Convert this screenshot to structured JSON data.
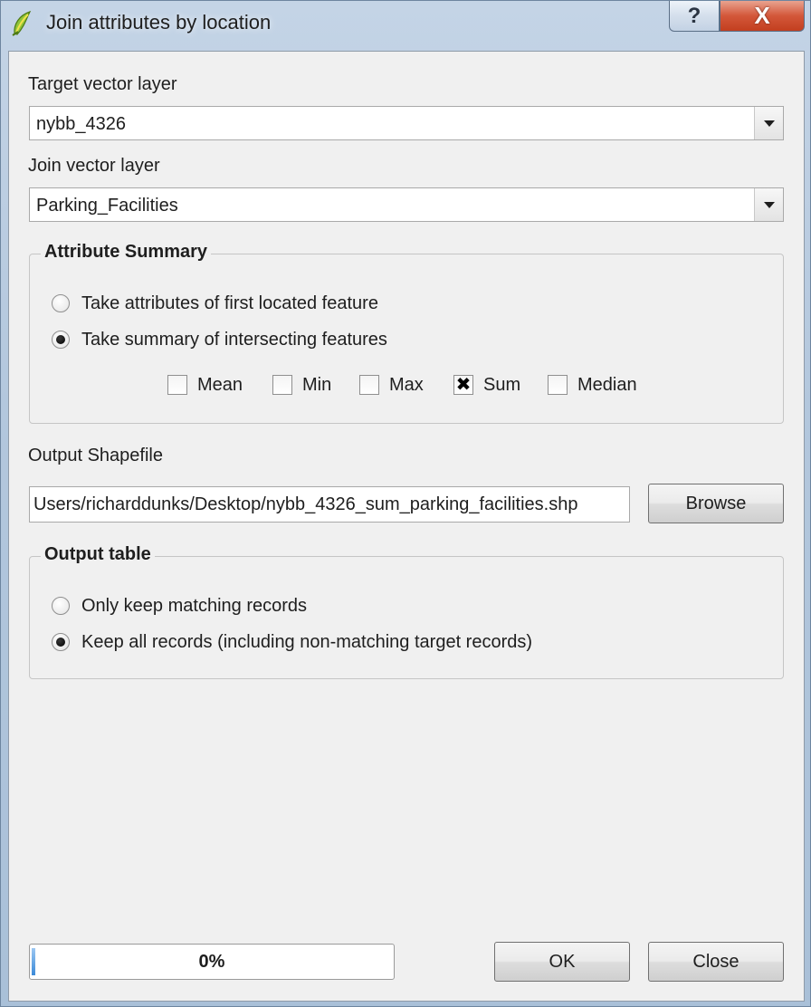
{
  "window": {
    "title": "Join attributes by location",
    "help_label": "?",
    "close_label": "X"
  },
  "target": {
    "label": "Target vector layer",
    "value": "nybb_4326"
  },
  "join": {
    "label": "Join vector layer",
    "value": "Parking_Facilities"
  },
  "summary": {
    "title": "Attribute Summary",
    "options": [
      {
        "label": "Take attributes of first located feature",
        "selected": false
      },
      {
        "label": "Take summary of intersecting features",
        "selected": true
      }
    ],
    "stats": [
      {
        "label": "Mean",
        "checked": false
      },
      {
        "label": "Min",
        "checked": false
      },
      {
        "label": "Max",
        "checked": false
      },
      {
        "label": "Sum",
        "checked": true
      },
      {
        "label": "Median",
        "checked": false
      }
    ],
    "checked_mark": "✖"
  },
  "output": {
    "label": "Output Shapefile",
    "value": "Users/richarddunks/Desktop/nybb_4326_sum_parking_facilities.shp",
    "browse_label": "Browse"
  },
  "output_table": {
    "title": "Output table",
    "options": [
      {
        "label": "Only keep matching records",
        "selected": false
      },
      {
        "label": "Keep all records (including non-matching target records)",
        "selected": true
      }
    ]
  },
  "progress": {
    "value": 0,
    "text": "0%"
  },
  "buttons": {
    "ok_label": "OK",
    "close_label": "Close"
  }
}
